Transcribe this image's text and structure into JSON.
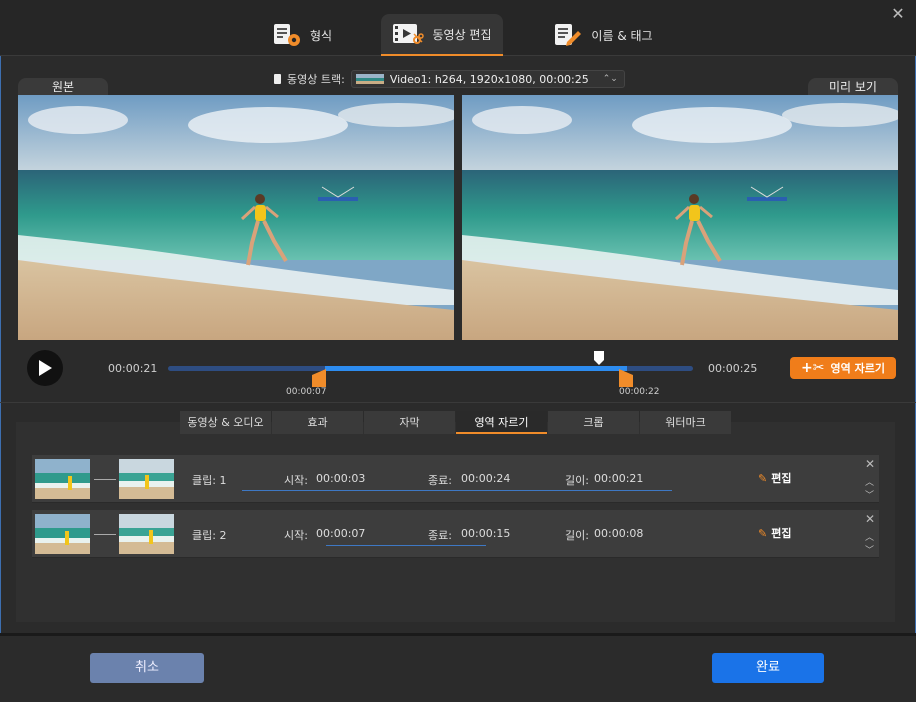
{
  "tabs": [
    {
      "label": "형식",
      "icon": "format-settings-icon"
    },
    {
      "label": "동영상 편집",
      "icon": "video-edit-icon"
    },
    {
      "label": "이름 & 태그",
      "icon": "name-tag-edit-icon"
    }
  ],
  "preview": {
    "original_label": "원본",
    "preview_label": "미리 보기",
    "track_label": "동영상 트랙:",
    "track_value": "Video1: h264, 1920x1080, 00:00:25"
  },
  "timeline": {
    "time_left": "00:00:21",
    "time_right": "00:00:25",
    "start_handle_time": "00:00:07",
    "end_handle_time": "00:00:22",
    "trim_button": "영역 자르기",
    "accent": "#f07d1a",
    "progress_color": "#2d8cf0"
  },
  "sub_tabs": [
    "동영상 & 오디오",
    "효과",
    "자막",
    "영역 자르기",
    "크롭",
    "워터마크"
  ],
  "clips": [
    {
      "clip": "클립: 1",
      "start_label": "시작:",
      "start": "00:00:03",
      "end_label": "종료:",
      "end": "00:00:24",
      "len_label": "길이:",
      "length": "00:00:21",
      "edit": "편집"
    },
    {
      "clip": "클립: 2",
      "start_label": "시작:",
      "start": "00:00:07",
      "end_label": "종료:",
      "end": "00:00:15",
      "len_label": "길이:",
      "length": "00:00:08",
      "edit": "편집"
    }
  ],
  "buttons": {
    "cancel": "취소",
    "done": "완료",
    "cancel_color": "#6b82ad",
    "done_color": "#1a73e8"
  }
}
